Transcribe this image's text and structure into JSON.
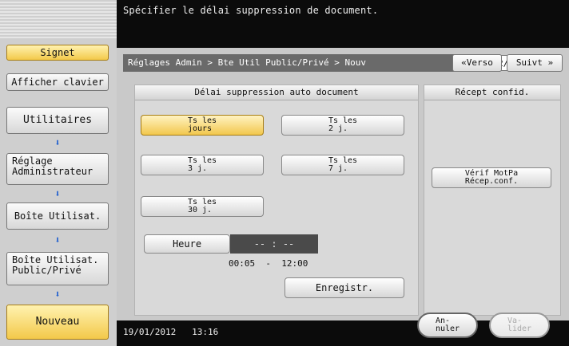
{
  "header": {
    "message": "Spécifier le délai suppression de document."
  },
  "sidebar": {
    "signet": "Signet",
    "afficher_clavier": "Afficher clavier",
    "items": [
      {
        "label": "Utilitaires"
      },
      {
        "label": "Réglage\nAdministrateur"
      },
      {
        "label": "Boîte Utilisat."
      },
      {
        "label": "Boîte Utilisat.\nPublic/Privé"
      }
    ],
    "nouveau": "Nouveau",
    "arrow_icon": "down-arrow-icon"
  },
  "main": {
    "breadcrumb": "Réglages Admin > Bte Util Public/Privé > Nouv",
    "page": "2/2",
    "verso": "«Verso",
    "suivt": "Suivt »",
    "left_panel_title": "Délai suppression auto document",
    "right_panel_title": "Récept confid.",
    "options": [
      {
        "label": "Ts les\njours",
        "selected": true
      },
      {
        "label": "Ts les\n2 j.",
        "selected": false
      },
      {
        "label": "Ts les\n3 j.",
        "selected": false
      },
      {
        "label": "Ts les\n7 j.",
        "selected": false
      },
      {
        "label": "Ts les\n30 j.",
        "selected": false
      }
    ],
    "heure_label": "Heure",
    "heure_value": "-- : --",
    "range": "00:05  -  12:00",
    "save_label": "Enregistr.",
    "verif_label": "Vérif MotPa\nRécep.conf."
  },
  "footer": {
    "datetime": "19/01/2012   13:16",
    "annuler": "An-\nnuler",
    "valider": "Va-\nlider"
  },
  "colors": {
    "accent_yellow": "#f3c94a",
    "blue_arrow": "#1f5fcf",
    "topbar": "#0b0b0b"
  }
}
